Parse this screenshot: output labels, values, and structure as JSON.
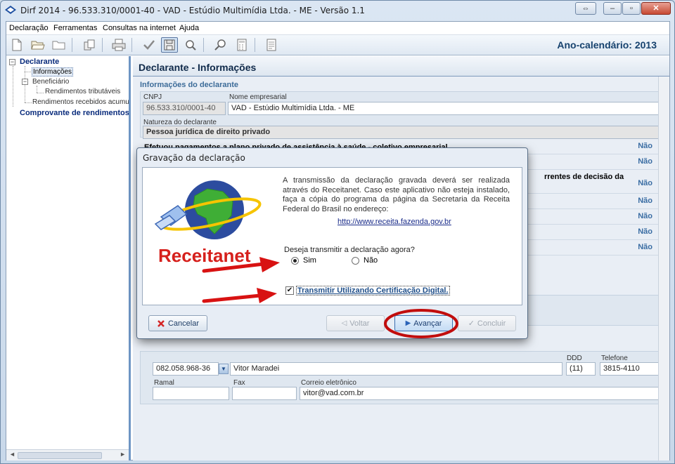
{
  "window": {
    "title": "Dirf 2014 - 96.533.310/0001-40 - VAD - Estúdio Multimídia Ltda. - ME - Versão 1.1"
  },
  "menu": [
    "Declaração",
    "Ferramentas",
    "Consultas na internet",
    "Ajuda"
  ],
  "toolbar": {
    "icons": [
      "new-file-icon",
      "open-folder-icon",
      "folder-icon",
      "copy-icon",
      "print-icon",
      "check-icon",
      "save-icon",
      "search-icon",
      "zoom-icon",
      "calculator-icon",
      "document-icon"
    ],
    "ano_calendario": "Ano-calendário: 2013"
  },
  "tree": {
    "declarante": "Declarante",
    "informacoes": "Informações",
    "beneficiario": "Beneficiário",
    "rendimentos_tributaveis": "Rendimentos tributáveis",
    "rendimentos_acumulados": "Rendimentos recebidos acumula",
    "comprovante": "Comprovante de rendimentos"
  },
  "main": {
    "title": "Declarante - Informações",
    "section_title": "Informações do declarante",
    "cnpj_label": "CNPJ",
    "cnpj_value": "96.533.310/0001-40",
    "nome_label": "Nome empresarial",
    "nome_value": "VAD - Estúdio Multimídia Ltda. - ME",
    "natureza_label": "Natureza do declarante",
    "natureza_value": "Pessoa jurídica de direito privado",
    "question_1": "Efetuou pagamentos a plano privado de assistência à saúde - coletivo empresarial",
    "question_partial": "rrentes de decisão da",
    "answers": [
      "Não",
      "Não",
      "Não",
      "Não",
      "Não",
      "Não",
      "Não"
    ],
    "responsavel": {
      "cpf_value": "082.058.968-36",
      "nome_value": "Vitor Maradei",
      "ddd_label": "DDD",
      "ddd_value": "(11)",
      "telefone_label": "Telefone",
      "telefone_value": "3815-4110",
      "ramal_label": "Ramal",
      "fax_label": "Fax",
      "email_label": "Correio eletrônico",
      "email_value": "vitor@vad.com.br"
    }
  },
  "dialog": {
    "title": "Gravação da declaração",
    "logo_text": "Receitanet",
    "message": "A transmissão da declaração gravada deverá ser realizada através do Receitanet. Caso este aplicativo não esteja instalado, faça a cópia do programa da página da Secretaria da Receita Federal do Brasil no endereço:",
    "link": "http://www.receita.fazenda.gov.br",
    "question": "Deseja transmitir a declaração agora?",
    "option_sim": "Sim",
    "option_nao": "Não",
    "selected_option": "Sim",
    "cert_label": "Transmitir Utilizando Certificação Digital.",
    "cert_checked": true,
    "buttons": {
      "cancel": "Cancelar",
      "back": "Voltar",
      "next": "Avançar",
      "finish": "Concluir"
    },
    "arrow_color": "#d81212"
  }
}
